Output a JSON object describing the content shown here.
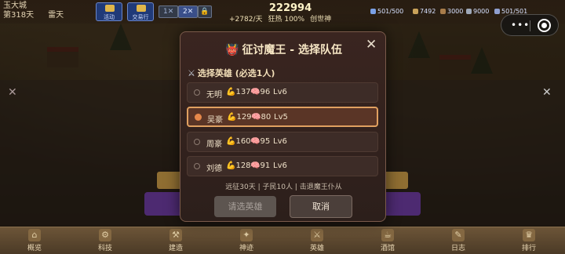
{
  "topbar": {
    "city_name": "玉大城",
    "day_label": "第318天",
    "weather": "雷天",
    "btn_activity": "活动",
    "btn_exchange": "交易行",
    "speed_1": "1✕",
    "speed_2": "2✕",
    "gold": "222994",
    "income": "+2782/天",
    "rate": "狂热 100%",
    "stage": "创世神",
    "res_1": "501/500",
    "res_2": "7492",
    "res_3": "3000",
    "res_4": "9000",
    "res_5": "501/501"
  },
  "modal": {
    "title": "征讨魔王 - 选择队伍",
    "section_label": "选择英雄 (必选1人)",
    "heroes": [
      {
        "name": "无明",
        "str": "137",
        "int": "96",
        "lv": "Lv6",
        "selected": false
      },
      {
        "name": "吴豪",
        "str": "129",
        "int": "80",
        "lv": "Lv5",
        "selected": true
      },
      {
        "name": "周豪",
        "str": "160",
        "int": "95",
        "lv": "Lv6",
        "selected": false
      },
      {
        "name": "刘德",
        "str": "128",
        "int": "91",
        "lv": "Lv6",
        "selected": false
      }
    ],
    "info": "远征30天 | 子民10人 | 击退魔王仆从",
    "confirm_label": "请选英雄",
    "cancel_label": "取消"
  },
  "bottom_nav": [
    {
      "label": "概览",
      "icon": "overview-icon"
    },
    {
      "label": "科技",
      "icon": "tech-icon"
    },
    {
      "label": "建造",
      "icon": "build-icon"
    },
    {
      "label": "神迹",
      "icon": "miracle-icon"
    },
    {
      "label": "英雄",
      "icon": "hero-icon"
    },
    {
      "label": "酒馆",
      "icon": "tavern-icon"
    },
    {
      "label": "日志",
      "icon": "log-icon"
    },
    {
      "label": "排行",
      "icon": "rank-icon"
    }
  ],
  "colors": {
    "selected_border": "#e0a060",
    "strength": "#f0c23a",
    "intelligence": "#f19aa8",
    "modal_bg": "#2c1f1b"
  }
}
